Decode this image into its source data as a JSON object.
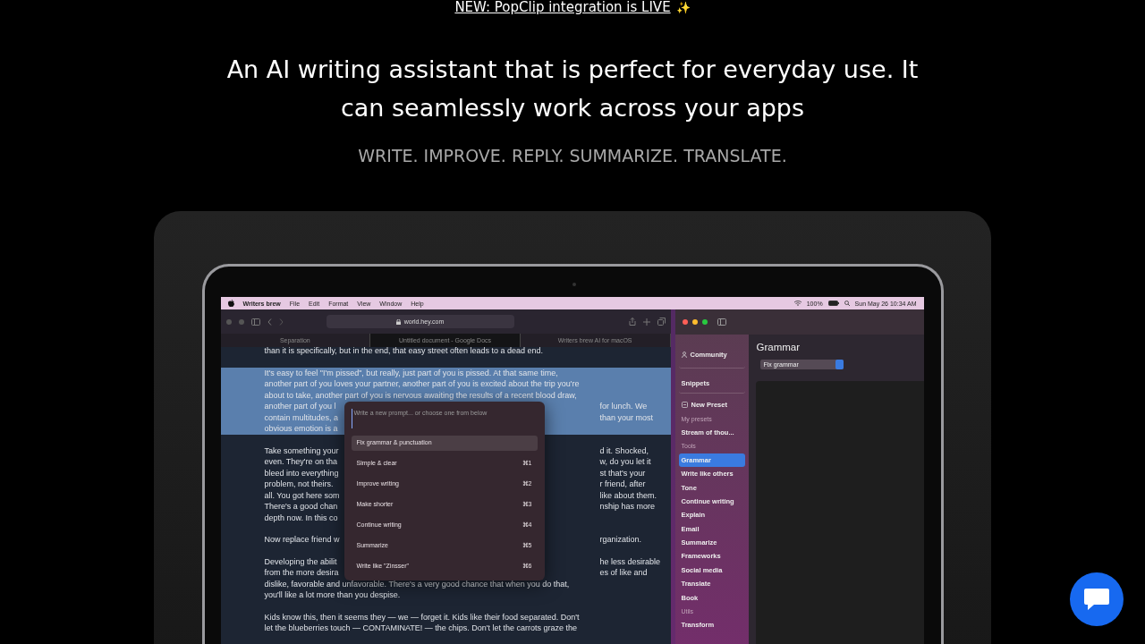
{
  "announcement": {
    "link": "NEW: PopClip integration is LIVE",
    "emoji": "✨"
  },
  "headline": "An AI writing assistant that is perfect for everyday use. It can seamlessly work across your apps",
  "tagline": "WRITE. IMPROVE. REPLY. SUMMARIZE. TRANSLATE.",
  "menu_bar": {
    "app": "Writers brew",
    "menus": [
      "File",
      "Edit",
      "Format",
      "View",
      "Window",
      "Help"
    ],
    "battery": "100%",
    "clock": "Sun May 26 10:34 AM"
  },
  "browser": {
    "url": "world.hey.com",
    "tabs": [
      {
        "label": "Separation",
        "selected": false
      },
      {
        "label": "Untitled document - Google Docs",
        "selected": true
      },
      {
        "label": "Writers brew AI for macOS",
        "selected": false
      }
    ],
    "paragraphs": [
      {
        "highlighted": false,
        "lines": [
          {
            "left": "than it is specifically, but in the end, that easy street often leads to a dead end."
          }
        ]
      },
      {
        "highlighted": true,
        "lines": [
          {
            "left": "It's easy to feel \"I'm pissed\", but really, just part of you is pissed. At that same time,"
          },
          {
            "left": "another part of you loves your partner, another part of you is excited about the trip you're"
          },
          {
            "left": "about to take, another part of you is nervous awaiting the results of a recent blood draw,"
          },
          {
            "left": "another part of you l",
            "right": "for lunch. We"
          },
          {
            "left": "contain multitudes, a",
            "right": "than your most"
          },
          {
            "left": "obvious emotion is a"
          }
        ]
      },
      {
        "highlighted": false,
        "lines": [
          {
            "left": "Take something your",
            "right": "d it. Shocked,"
          },
          {
            "left": "even. They're on tha",
            "right": "w, do you let it"
          },
          {
            "left": "bleed into everything",
            "right": "st that's your"
          },
          {
            "left": "problem, not theirs.",
            "right": "r friend, after"
          },
          {
            "left": "all. You got here som",
            "right": "like about them."
          },
          {
            "left": "There's a good chan",
            "right": "nship has more"
          },
          {
            "left": "depth now. In this co"
          }
        ]
      },
      {
        "highlighted": false,
        "lines": [
          {
            "left": "Now replace friend w",
            "right": "rganization."
          }
        ]
      },
      {
        "highlighted": false,
        "lines": [
          {
            "left": "Developing the abilit",
            "right": "he less desirable"
          },
          {
            "left": "from the more desira",
            "right": "es of like and"
          },
          {
            "left": "dislike, favorable and unfavorable. There's a very good chance that when you do that,"
          },
          {
            "left": "you'll like a lot more than you despise."
          }
        ]
      },
      {
        "highlighted": false,
        "lines": [
          {
            "left": "Kids know this, then it seems they — we — forget it. Kids like their food separated. Don't"
          },
          {
            "left": "let the blueberries touch — CONTAMINATE! — the chips. Don't let the carrots graze the"
          }
        ]
      }
    ]
  },
  "prompt_popup": {
    "placeholder": "Write a new prompt... or choose one from below",
    "items": [
      {
        "label": "Fix grammar & punctuation",
        "selected": true
      },
      {
        "label": "Simple & clear",
        "shortcut": "⌘1",
        "selected": false
      },
      {
        "label": "Improve writing",
        "shortcut": "⌘2",
        "selected": false
      },
      {
        "label": "Make shorter",
        "shortcut": "⌘3",
        "selected": false
      },
      {
        "label": "Continue writing",
        "shortcut": "⌘4",
        "selected": false
      },
      {
        "label": "Summarize",
        "shortcut": "⌘5",
        "selected": false
      },
      {
        "label": "Write like \"Zinsser\"",
        "shortcut": "⌘6",
        "selected": false
      }
    ]
  },
  "app_window": {
    "sidebar": [
      {
        "kind": "community",
        "label": "Community",
        "selected": false
      },
      {
        "kind": "link",
        "label": "Snippets",
        "selected": false
      },
      {
        "kind": "new",
        "label": "New Preset",
        "selected": false
      },
      {
        "kind": "header",
        "label": "My presets"
      },
      {
        "kind": "item",
        "label": "Stream of thou...",
        "selected": false
      },
      {
        "kind": "header",
        "label": "Tools"
      },
      {
        "kind": "item",
        "label": "Grammar",
        "selected": true
      },
      {
        "kind": "item",
        "label": "Write like others",
        "selected": false
      },
      {
        "kind": "item",
        "label": "Tone",
        "selected": false
      },
      {
        "kind": "item",
        "label": "Continue writing",
        "selected": false
      },
      {
        "kind": "item",
        "label": "Explain",
        "selected": false
      },
      {
        "kind": "item",
        "label": "Email",
        "selected": false
      },
      {
        "kind": "item",
        "label": "Summarize",
        "selected": false
      },
      {
        "kind": "item",
        "label": "Frameworks",
        "selected": false
      },
      {
        "kind": "item",
        "label": "Social media",
        "selected": false
      },
      {
        "kind": "item",
        "label": "Translate",
        "selected": false
      },
      {
        "kind": "item",
        "label": "Book",
        "selected": false
      },
      {
        "kind": "header",
        "label": "Utils"
      },
      {
        "kind": "item",
        "label": "Transform",
        "selected": false
      }
    ],
    "title": "Grammar",
    "dropdown": "Fix grammar"
  }
}
